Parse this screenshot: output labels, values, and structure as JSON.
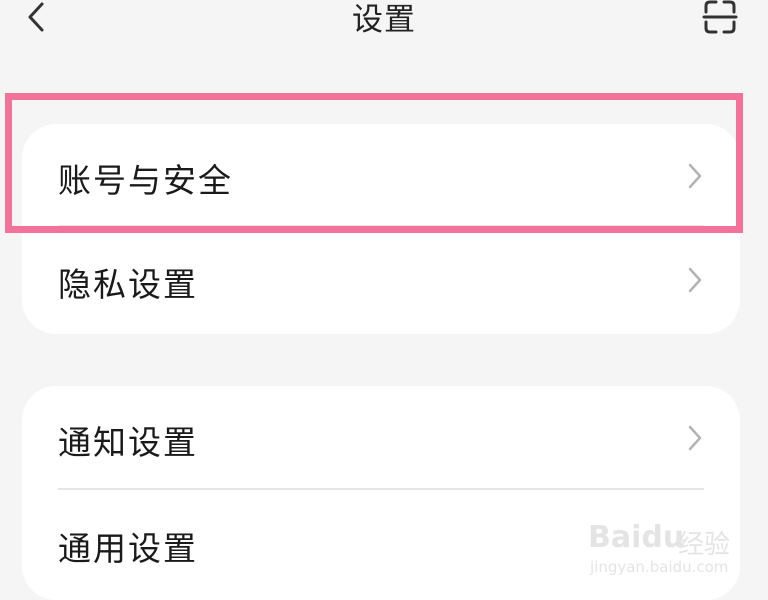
{
  "header": {
    "title": "设置",
    "back_icon": "chevron-left-icon",
    "scan_icon": "scan-icon"
  },
  "groups": [
    {
      "items": [
        {
          "label": "账号与安全",
          "icon": "chevron-right-icon",
          "highlighted": true
        },
        {
          "label": "隐私设置",
          "icon": "chevron-right-icon"
        }
      ]
    },
    {
      "items": [
        {
          "label": "通知设置",
          "icon": "chevron-right-icon"
        },
        {
          "label": "通用设置",
          "icon": "chevron-right-icon"
        }
      ]
    }
  ],
  "highlight_color": "#f2729a",
  "watermark": {
    "brand": "Baidu",
    "jingyan": "经验",
    "url": "jingyan.baidu.com"
  }
}
